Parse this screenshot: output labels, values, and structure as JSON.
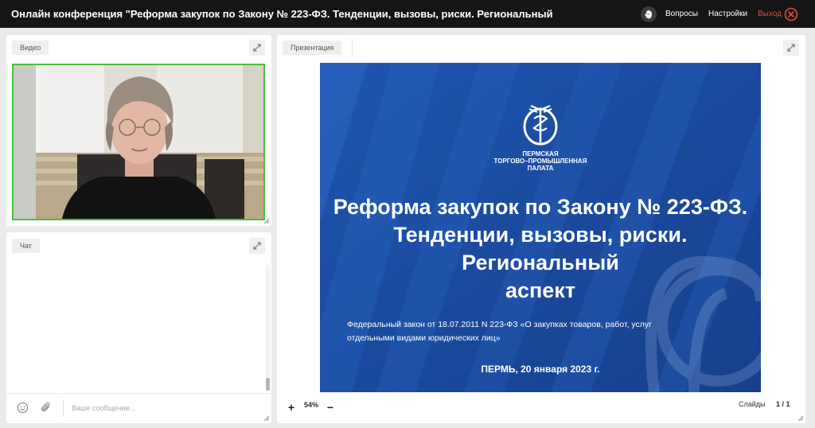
{
  "header": {
    "title": "Онлайн конференция \"Реформа закупок по Закону № 223-ФЗ. Тенденции, вызовы, риски. Региональный",
    "questions_label": "Вопросы",
    "settings_label": "Настройки",
    "exit_label": "Выход",
    "icons": [
      "raise-hand-icon",
      "close-circle-icon"
    ]
  },
  "video_panel": {
    "tab_label": "Видео",
    "active_speaker_color": "#4cbf3c"
  },
  "chat_panel": {
    "tab_label": "Чат",
    "input_placeholder": "Ваше сообщение...",
    "icons": [
      "emoji-icon",
      "attach-icon"
    ]
  },
  "presentation_panel": {
    "tab_label": "Презентация",
    "zoom_level": "54%",
    "slides_label": "Слайды",
    "slide_counter": "1 / 1",
    "slide": {
      "org_lines": [
        "ПЕРМСКАЯ",
        "ТОРГОВО–ПРОМЫШЛЕННАЯ",
        "ПАЛАТА"
      ],
      "title_lines": [
        "Реформа закупок по Закону № 223-ФЗ.",
        "Тенденции, вызовы, риски. Региональный",
        "аспект"
      ],
      "law_lines": [
        "Федеральный закон от 18.07.2011 N 223-ФЗ «О закупках товаров, работ, услуг",
        "отдельными видами юридических лиц»"
      ],
      "date_text": "ПЕРМЬ, 20 января 2023 г.",
      "background_color": "#1c4fa4"
    }
  },
  "colors": {
    "topbar": "#151515",
    "exit": "#e74c3c",
    "page_bg": "#ebebeb"
  }
}
